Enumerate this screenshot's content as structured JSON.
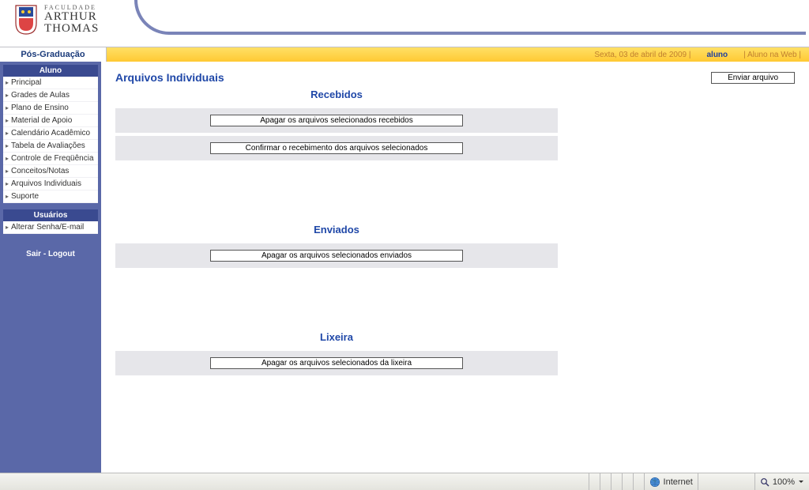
{
  "logo": {
    "top": "FACULDADE",
    "name_line1": "ARTHUR",
    "name_line2": "THOMAS"
  },
  "yellowbar": {
    "section": "Pós-Graduação",
    "date": "Sexta, 03 de abril de 2009 |",
    "user": "aluno",
    "role": "| Aluno na Web |"
  },
  "sidebar": {
    "box1_title": "Aluno",
    "items1": [
      "Principal",
      "Grades de Aulas",
      "Plano de Ensino",
      "Material de Apoio",
      "Calendário Acadêmico",
      "Tabela de Avaliações",
      "Controle de Freqüência",
      "Conceitos/Notas",
      "Arquivos Individuais",
      "Suporte"
    ],
    "box2_title": "Usuários",
    "items2": [
      "Alterar Senha/E-mail"
    ],
    "logout": "Sair - Logout"
  },
  "main": {
    "page_title": "Arquivos Individuais",
    "upload_button": "Enviar arquivo",
    "sections": {
      "received": {
        "title": "Recebidos",
        "btn_delete": "Apagar os arquivos selecionados recebidos",
        "btn_confirm": "Confirmar o recebimento dos arquivos selecionados"
      },
      "sent": {
        "title": "Enviados",
        "btn_delete": "Apagar os arquivos selecionados enviados"
      },
      "trash": {
        "title": "Lixeira",
        "btn_delete": "Apagar os arquivos selecionados da lixeira"
      }
    }
  },
  "statusbar": {
    "zone": "Internet",
    "zoom": "100%"
  }
}
